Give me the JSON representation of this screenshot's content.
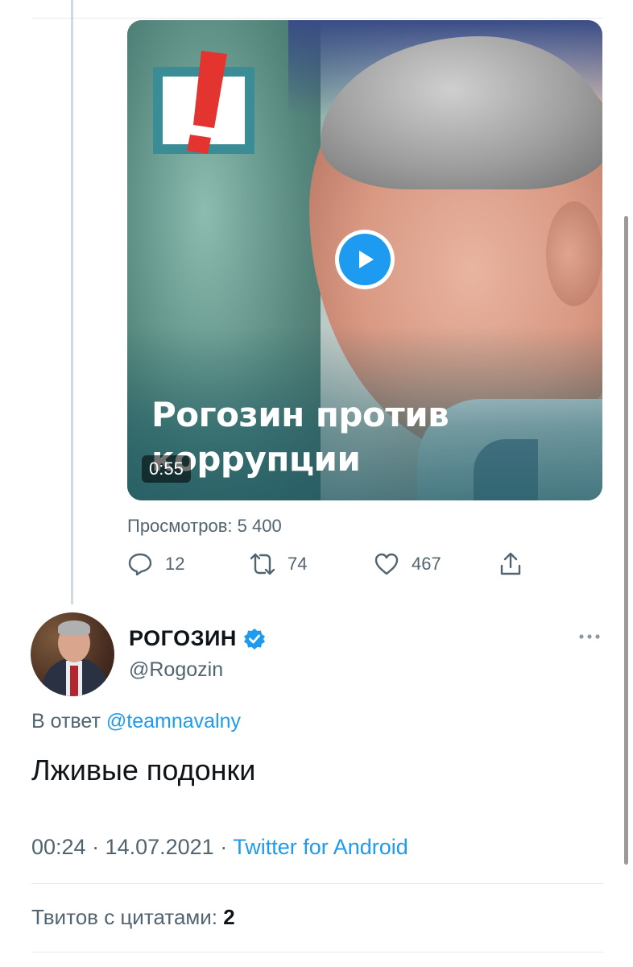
{
  "video": {
    "logo_icon": "navalny-exclamation-logo",
    "title": "Рогозин против коррупции",
    "duration": "0:55",
    "play_icon": "play-icon"
  },
  "views": "Просмотров: 5 400",
  "actions": {
    "reply_count": "12",
    "retweet_count": "74",
    "like_count": "467"
  },
  "reply_tweet": {
    "display_name": "РОГОЗИН",
    "handle": "@Rogozin",
    "reply_prefix": "В ответ",
    "reply_to_handle": "@teamnavalny",
    "text": "Лживые подонки",
    "time": "00:24 · 14.07.2021 · ",
    "source": "Twitter for Android",
    "quote_label": "Твитов с цитатами: ",
    "quote_count": "2"
  },
  "colors": {
    "accent": "#1d9bf0",
    "muted": "#536471",
    "text": "#0f1419",
    "logo_red": "#e3342f",
    "logo_teal": "#3a8c96"
  }
}
